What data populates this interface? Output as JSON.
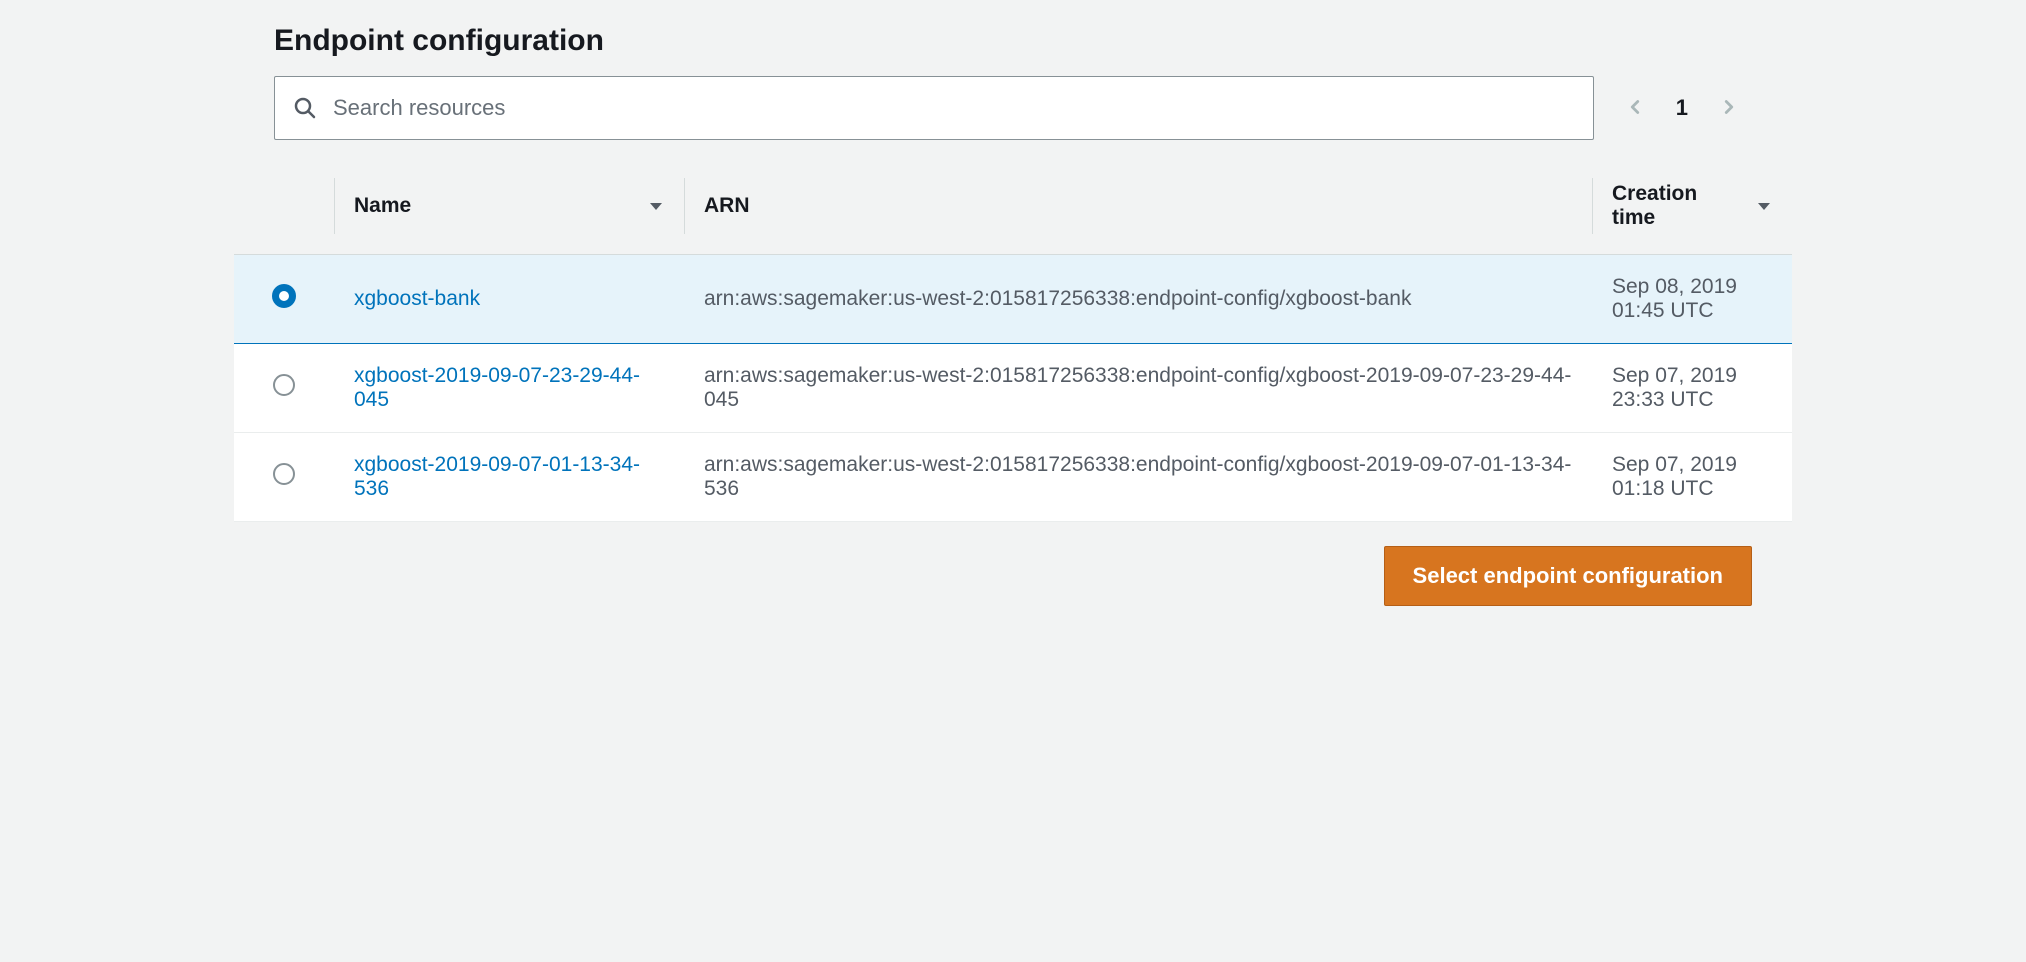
{
  "header": {
    "title": "Endpoint configuration"
  },
  "search": {
    "placeholder": "Search resources",
    "value": ""
  },
  "pager": {
    "current": "1"
  },
  "table": {
    "columns": {
      "name": "Name",
      "arn": "ARN",
      "creation_time": "Creation time"
    },
    "rows": [
      {
        "selected": true,
        "name": "xgboost-bank",
        "arn": "arn:aws:sagemaker:us-west-2:015817256338:endpoint-config/xgboost-bank",
        "creation_time": "Sep 08, 2019 01:45 UTC"
      },
      {
        "selected": false,
        "name": "xgboost-2019-09-07-23-29-44-045",
        "arn": "arn:aws:sagemaker:us-west-2:015817256338:endpoint-config/xgboost-2019-09-07-23-29-44-045",
        "creation_time": "Sep 07, 2019 23:33 UTC"
      },
      {
        "selected": false,
        "name": "xgboost-2019-09-07-01-13-34-536",
        "arn": "arn:aws:sagemaker:us-west-2:015817256338:endpoint-config/xgboost-2019-09-07-01-13-34-536",
        "creation_time": "Sep 07, 2019 01:18 UTC"
      }
    ]
  },
  "actions": {
    "select_button": "Select endpoint configuration"
  }
}
